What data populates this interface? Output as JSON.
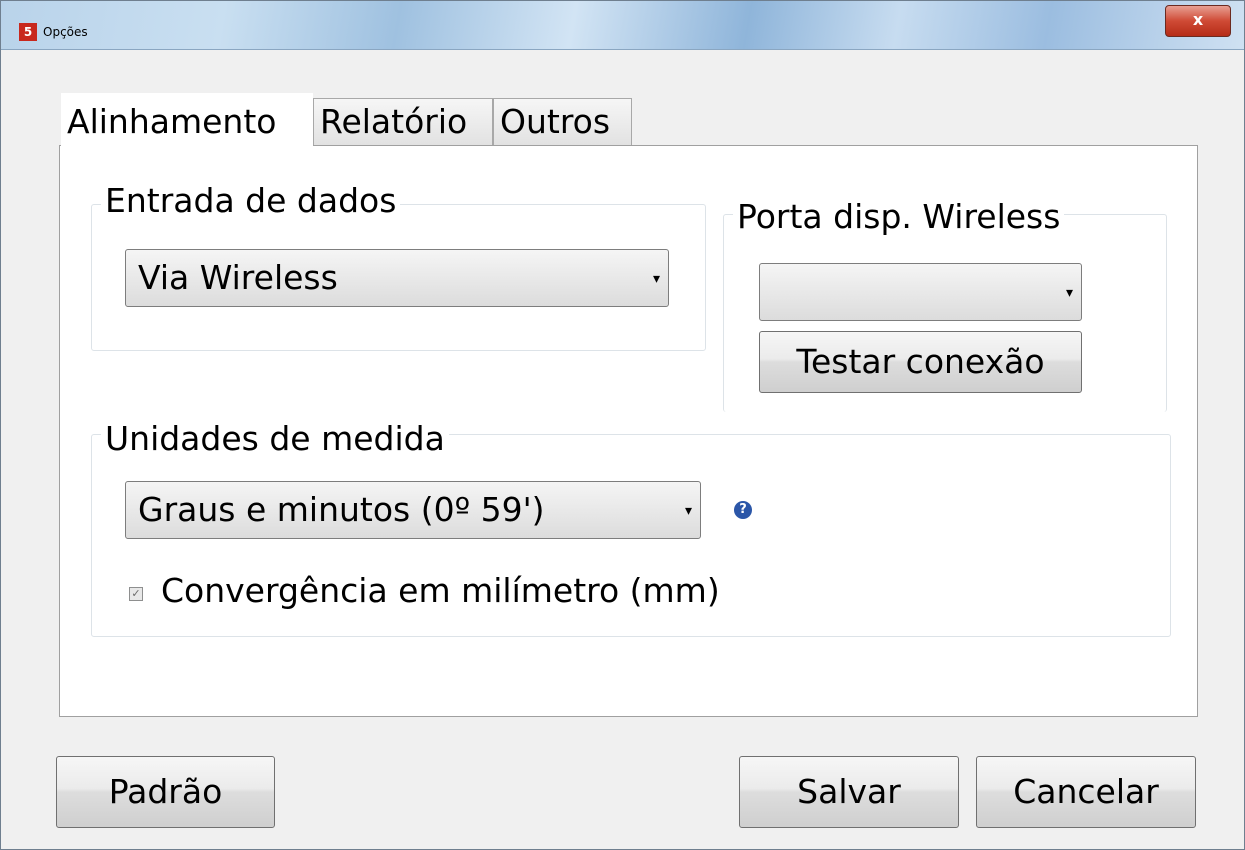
{
  "window": {
    "title": "Opções",
    "app_icon": "5",
    "close_glyph": "x"
  },
  "tabs": [
    {
      "label": "Alinhamento",
      "selected": true
    },
    {
      "label": "Relatório",
      "selected": false
    },
    {
      "label": "Outros",
      "selected": false
    }
  ],
  "data_entry": {
    "title": "Entrada de dados",
    "value": "Via Wireless"
  },
  "wireless_port": {
    "title": "Porta disp. Wireless",
    "value": "",
    "test_button": "Testar conexão"
  },
  "units": {
    "title": "Unidades de medida",
    "value": "Graus e minutos (0º 59')",
    "help_glyph": "?",
    "checkbox_label": "Convergência em milímetro (mm)",
    "checkbox_checked": true,
    "check_glyph": "✓"
  },
  "dropdown_glyph": "▾",
  "footer": {
    "default_button": "Padrão",
    "save_button": "Salvar",
    "cancel_button": "Cancelar"
  },
  "colors": {
    "close_button": "#c8432e",
    "help_icon": "#2b56a8",
    "app_icon": "#c8281d"
  }
}
